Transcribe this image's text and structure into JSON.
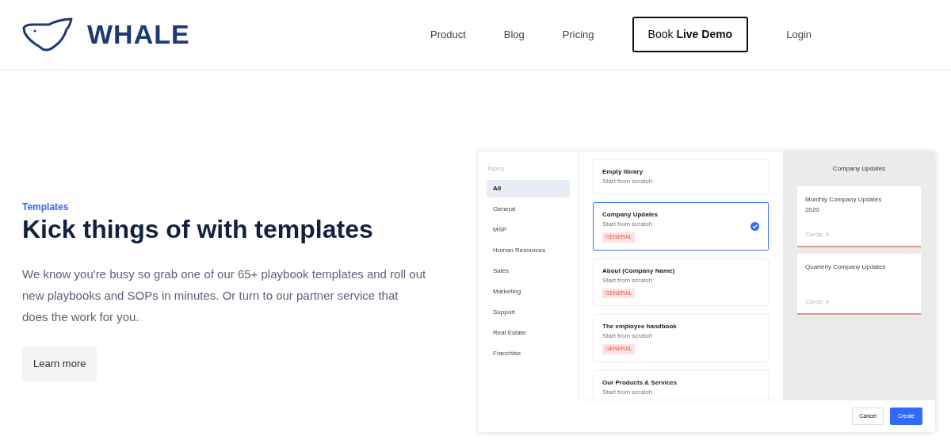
{
  "brand": {
    "name": "WHALE"
  },
  "nav": [
    {
      "label": "Product",
      "kind": "link"
    },
    {
      "label": "Blog",
      "kind": "link"
    },
    {
      "label": "Pricing",
      "kind": "link"
    },
    {
      "label": "Book **Live Demo**",
      "kind": "cta"
    },
    {
      "label": "Login",
      "kind": "link"
    }
  ],
  "hero": {
    "eyebrow": "Templates",
    "title": "Kick things of with templates",
    "body": "We know you're busy so grab one of our 65+ playbook templates and roll out new playbooks and SOPs in minutes. Or turn to our partner service that does the work for you.",
    "button": "Learn more"
  },
  "mockup": {
    "topics_heading": "Topics",
    "topics": [
      {
        "label": "All",
        "selected": true
      },
      {
        "label": "General",
        "selected": false
      },
      {
        "label": "MSP",
        "selected": false
      },
      {
        "label": "Human Resources",
        "selected": false
      },
      {
        "label": "Sales",
        "selected": false
      },
      {
        "label": "Marketing",
        "selected": false
      },
      {
        "label": "Support",
        "selected": false
      },
      {
        "label": "Real Estate",
        "selected": false
      },
      {
        "label": "Franchise",
        "selected": false
      }
    ],
    "templates": [
      {
        "title": "Empty library",
        "subtitle": "Start from scratch",
        "selected": false
      },
      {
        "title": "Company Updates",
        "subtitle": "Start from scratch",
        "tag": "GENERAL",
        "selected": true
      },
      {
        "title": "About (Company Name)",
        "subtitle": "Start from scratch",
        "tag": "GENERAL",
        "selected": false
      },
      {
        "title": "The employee handbook",
        "subtitle": "Start from scratch",
        "tag": "GENERAL",
        "selected": false
      },
      {
        "title": "Our Products & Services",
        "subtitle": "Start from scratch",
        "selected": false
      }
    ],
    "preview": {
      "title": "Company Updates",
      "cards": [
        {
          "title": "Monthly Company Updates 2020",
          "meta": "Cards: 4"
        },
        {
          "title": "Quarterly Company Updates",
          "meta": "Cards: 4"
        }
      ]
    },
    "buttons": [
      {
        "label": "Cancel",
        "kind": "secondary"
      },
      {
        "label": "Create",
        "kind": "primary"
      }
    ]
  }
}
